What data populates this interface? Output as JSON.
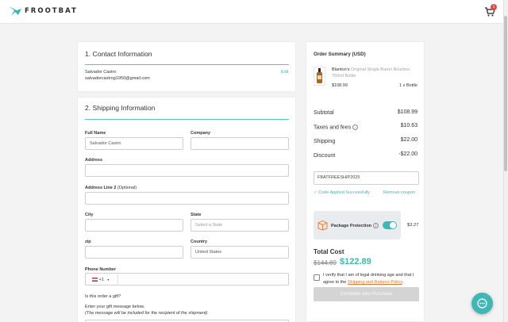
{
  "header": {
    "brand": "FROOTBAT",
    "cart_count": "1"
  },
  "contact": {
    "title": "1. Contact Information",
    "name": "Salvador Castro",
    "email": "salvadorcastrog1950@gmail.com",
    "edit_label": "Edit"
  },
  "shipping": {
    "title": "2. Shipping Information",
    "full_name_label": "Full Name",
    "full_name_value": "Salvador Castro",
    "company_label": "Company",
    "address_label": "Address",
    "address2_label": "Address Line 2",
    "address2_optional": "(Optional)",
    "city_label": "City",
    "state_label": "State",
    "state_placeholder": "Select a State",
    "zip_label": "zip",
    "country_label": "Country",
    "country_value": "United States",
    "phone_label": "Phone Number",
    "phone_code": "+1",
    "gift_question": "Is this order a gift?",
    "gift_message_label": "Enter your gift message below.",
    "gift_note": "(The message will be included for the recipient of the shipment)"
  },
  "order": {
    "title": "Order Summary (USD)",
    "product_brand": "Blanton's",
    "product_variant": "Original Single Barrel Bourbon 750ml Bottle",
    "product_price": "$108.99",
    "product_qty": "1 x Bottle",
    "subtotal_label": "Subtotal",
    "subtotal_value": "$108.99",
    "taxes_label": "Taxes and fees",
    "taxes_value": "$10.63",
    "shipping_label": "Shipping",
    "shipping_value": "$22.00",
    "discount_label": "Discount",
    "discount_value": "-$22.00",
    "coupon_code": "FBATFREESHIP2025",
    "coupon_applied": "Code Applied Successfully",
    "remove_coupon": "Remove coupon",
    "package_protection_label": "Package Protection",
    "package_protection_price": "$3.27",
    "package_protection_on": true,
    "total_label": "Total Cost",
    "total_old": "$144.89",
    "total_new": "$122.89",
    "verify_text": "I verify that I am of legal drinking age and that I agree to the",
    "policy_link": "Shipping and Returns Policy",
    "verify_end": ".",
    "cta_label": "Complete your Purchase"
  },
  "colors": {
    "accent": "#3fb7b5",
    "line": "#54c6c4",
    "link_orange": "#e8742d",
    "badge": "#e04848"
  }
}
